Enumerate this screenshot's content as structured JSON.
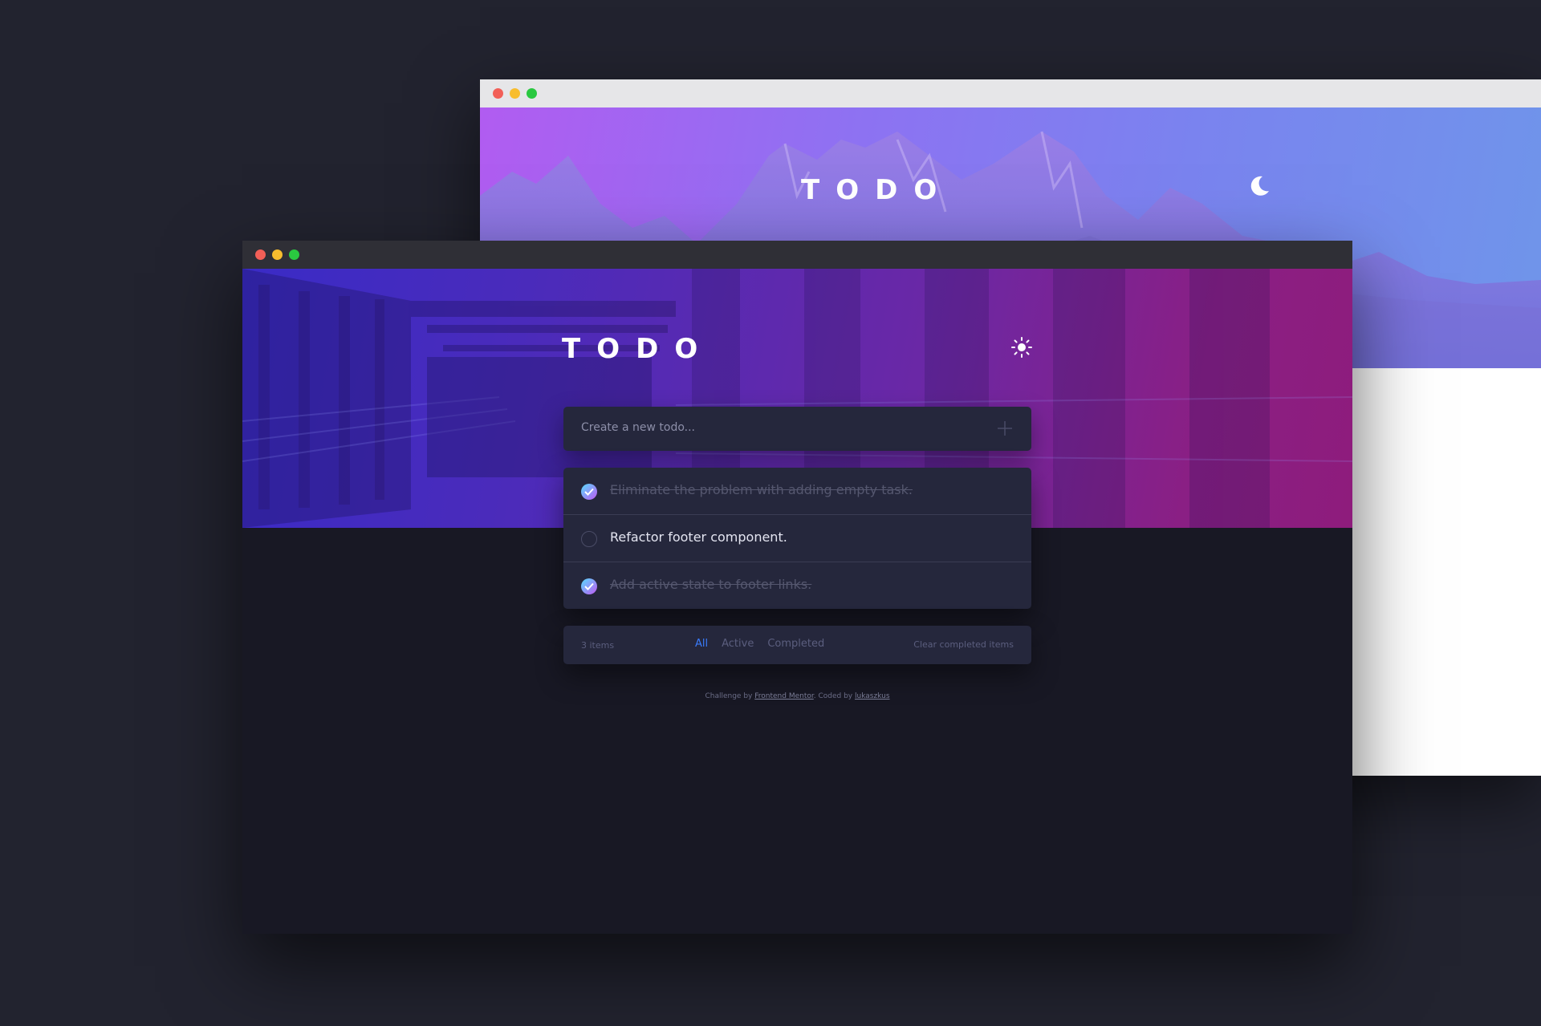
{
  "back_window": {
    "app_title": "TODO",
    "theme_toggle_icon": "moon-icon"
  },
  "front_window": {
    "app_title": "TODO",
    "theme_toggle_icon": "sun-icon",
    "create_input": {
      "placeholder": "Create a new todo...",
      "add_icon": "plus-icon"
    },
    "todos": [
      {
        "text": "Eliminate the problem with adding empty task.",
        "completed": true
      },
      {
        "text": "Refactor footer component.",
        "completed": false
      },
      {
        "text": "Add active state to footer links.",
        "completed": true
      }
    ],
    "footer": {
      "items_left": "3 items",
      "filters": [
        "All",
        "Active",
        "Completed"
      ],
      "active_filter": "All",
      "clear_label": "Clear completed items"
    },
    "credits": {
      "prefix": "Challenge by",
      "challenge_link": "Frontend Mentor",
      "middle": ". Coded by",
      "author_link": "lukaszkus"
    }
  },
  "colors": {
    "page_background": "#22232f",
    "accent_blue": "#3a7cfd",
    "card_dark": "#25273c",
    "check_gradient_start": "#57ddff",
    "check_gradient_end": "#c058f3"
  }
}
